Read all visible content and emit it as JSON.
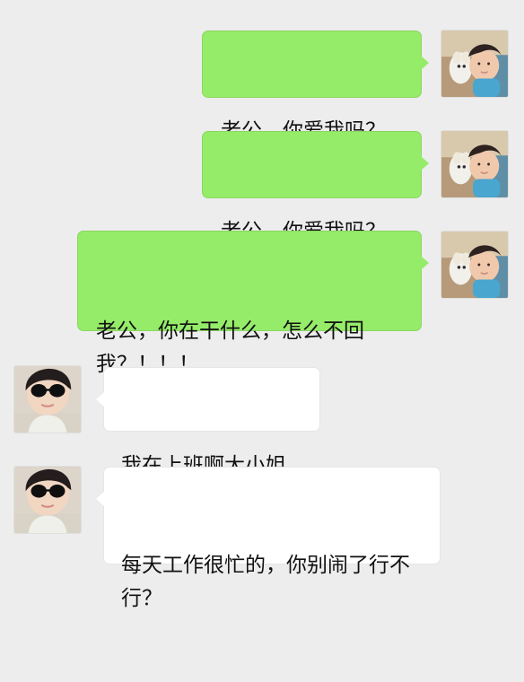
{
  "messages": [
    {
      "sender": "self",
      "text": "老公，你爱我吗？"
    },
    {
      "sender": "self",
      "text": "老公，你爱我吗？"
    },
    {
      "sender": "self",
      "text": "老公，你在干什么，怎么不回我？！！！"
    },
    {
      "sender": "other",
      "text": "我在上班啊大小姐"
    },
    {
      "sender": "other",
      "text": "每天工作很忙的，你别闹了行不行？"
    }
  ],
  "colors": {
    "background": "#ededed",
    "self_bubble": "#95ec69",
    "other_bubble": "#ffffff",
    "text": "#111111"
  },
  "icons": {
    "self_avatar": "child-with-dog-avatar",
    "other_avatar": "person-with-sunglasses-avatar"
  }
}
